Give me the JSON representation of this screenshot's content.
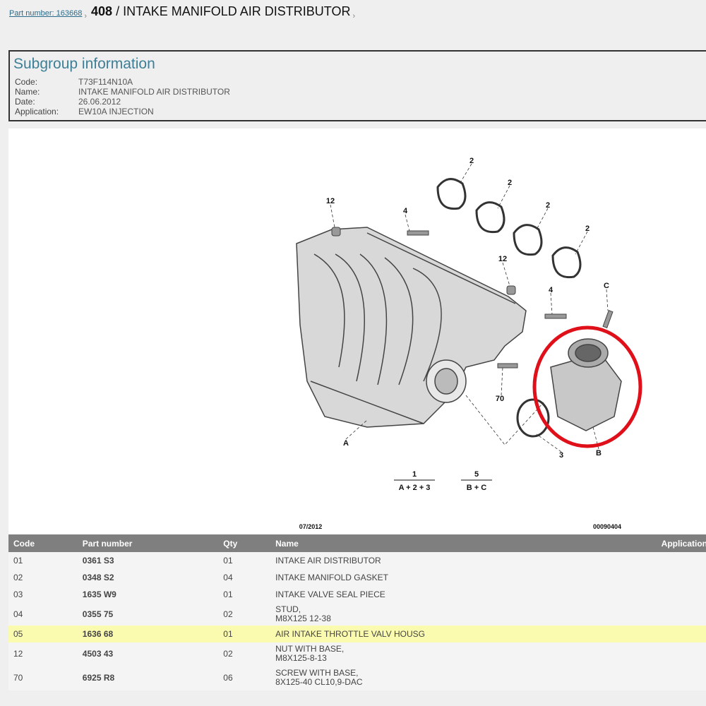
{
  "breadcrumb": {
    "link": "Part number: 163668",
    "title_bold": "408",
    "title_rest": " / INTAKE MANIFOLD AIR DISTRIBUTOR",
    "sep": "›"
  },
  "subgroup": {
    "heading": "Subgroup information",
    "fields": [
      {
        "label": "Code:",
        "value": "T73F114N10A"
      },
      {
        "label": "Name:",
        "value": "INTAKE MANIFOLD AIR DISTRIBUTOR"
      },
      {
        "label": "Date:",
        "value": "26.06.2012"
      },
      {
        "label": "Application:",
        "value": "EW10A INJECTION"
      }
    ]
  },
  "diagram": {
    "callouts": [
      "2",
      "2",
      "2",
      "2",
      "12",
      "12",
      "4",
      "4",
      "C",
      "70",
      "3",
      "B",
      "A"
    ],
    "formula1_top": "1",
    "formula1_bottom": "A + 2 + 3",
    "formula2_top": "5",
    "formula2_bottom": "B + C",
    "date": "07/2012",
    "ref": "00090404",
    "highlight_color": "#e0101a"
  },
  "table": {
    "headers": [
      "Code",
      "Part number",
      "Qty",
      "Name",
      "Application"
    ],
    "rows": [
      {
        "code": "01",
        "part": "0361 S3",
        "qty": "01",
        "name": "INTAKE AIR DISTRIBUTOR",
        "name2": ""
      },
      {
        "code": "02",
        "part": "0348 S2",
        "qty": "04",
        "name": "INTAKE MANIFOLD GASKET",
        "name2": ""
      },
      {
        "code": "03",
        "part": "1635 W9",
        "qty": "01",
        "name": "INTAKE VALVE SEAL PIECE",
        "name2": ""
      },
      {
        "code": "04",
        "part": "0355 75",
        "qty": "02",
        "name": "STUD,",
        "name2": "M8X125 12-38"
      },
      {
        "code": "05",
        "part": "1636 68",
        "qty": "01",
        "name": "AIR INTAKE THROTTLE VALV HOUSG",
        "name2": ""
      },
      {
        "code": "12",
        "part": "4503 43",
        "qty": "02",
        "name": "NUT WITH BASE,",
        "name2": "M8X125-8-13"
      },
      {
        "code": "70",
        "part": "6925 R8",
        "qty": "06",
        "name": "SCREW WITH BASE,",
        "name2": "8X125-40 CL10,9-DAC"
      }
    ]
  }
}
